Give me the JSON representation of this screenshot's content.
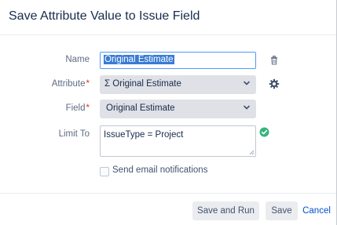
{
  "dialog": {
    "title": "Save Attribute Value to Issue Field"
  },
  "form": {
    "name": {
      "label": "Name",
      "value": "Original Estimate"
    },
    "attribute": {
      "label": "Attribute",
      "required_marker": "*",
      "value": "Σ Original Estimate"
    },
    "field": {
      "label": "Field",
      "required_marker": "*",
      "value": "Original Estimate"
    },
    "limit_to": {
      "label": "Limit To",
      "value": "IssueType = Project"
    },
    "send_email": {
      "label": "Send email notifications",
      "checked": false
    }
  },
  "icons": {
    "delete": "trash-icon",
    "settings": "gear-icon",
    "valid": "check-circle-icon",
    "dropdown": "chevron-down-icon"
  },
  "footer": {
    "save_and_run_label": "Save and Run",
    "save_label": "Save",
    "cancel_label": "Cancel"
  },
  "colors": {
    "accent": "#0052cc",
    "required": "#de350b",
    "valid": "#36b37e",
    "selection": "#3a7bd5"
  }
}
